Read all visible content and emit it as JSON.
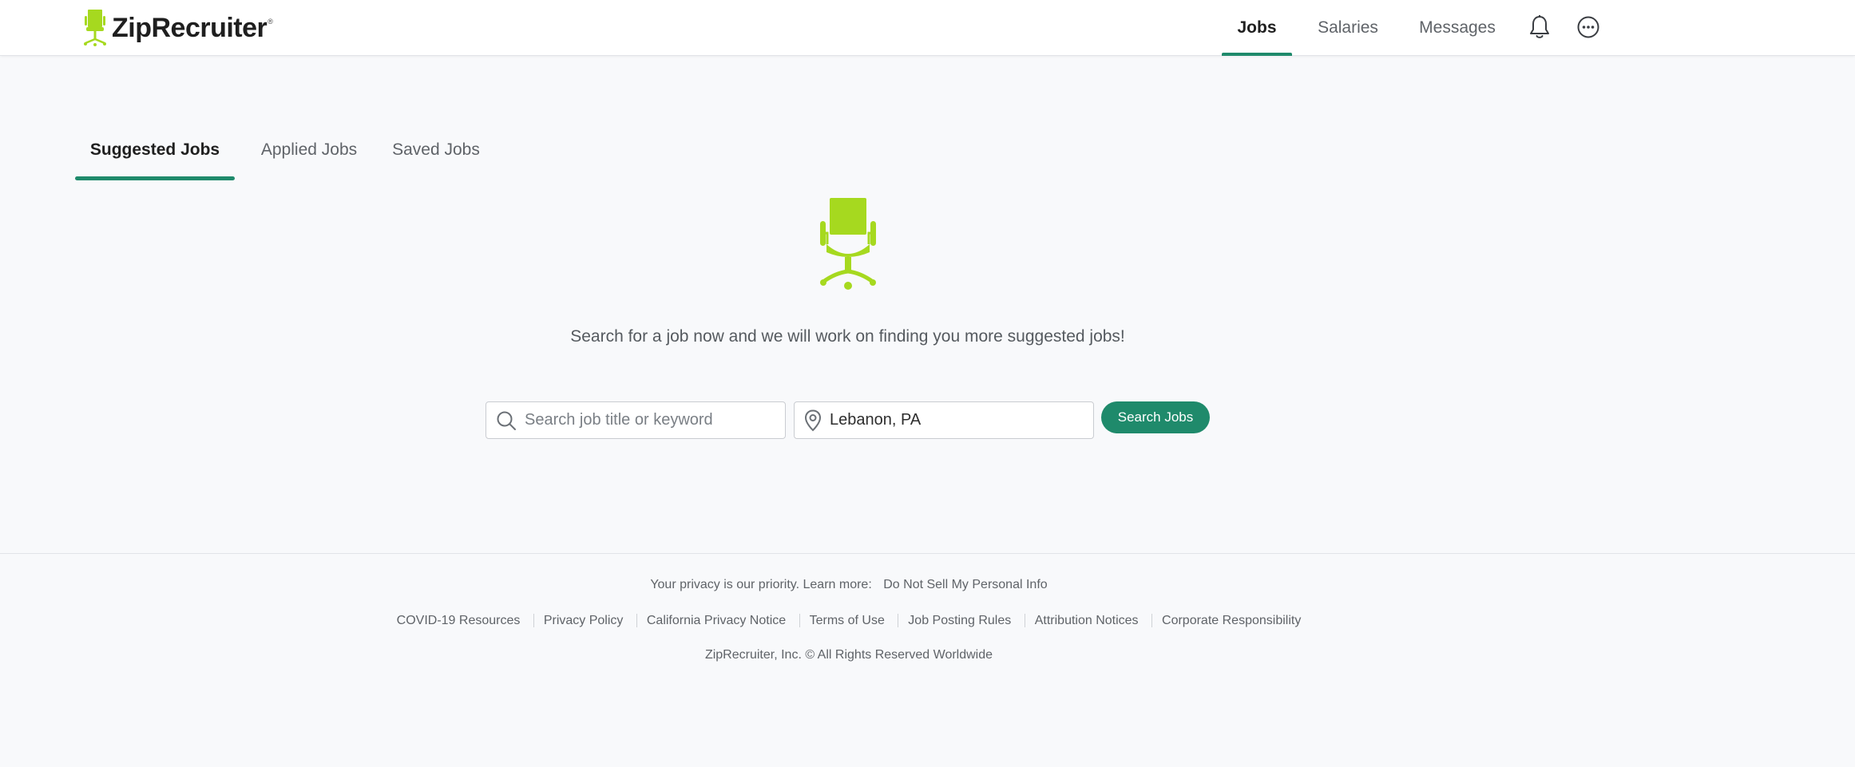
{
  "brand": {
    "name": "ZipRecruiter",
    "trademark": "®",
    "accent_color": "#1f8a6b",
    "logo_color": "#a6d91f"
  },
  "nav": {
    "jobs": "Jobs",
    "salaries": "Salaries",
    "messages": "Messages",
    "notifications_icon": "bell-icon",
    "more_icon": "more-options-icon"
  },
  "tabs": {
    "suggested": "Suggested Jobs",
    "applied": "Applied Jobs",
    "saved": "Saved Jobs",
    "active": "Suggested Jobs"
  },
  "empty_state": {
    "message": "Search for a job now and we will work on finding you more suggested jobs!"
  },
  "search": {
    "keyword_placeholder": "Search job title or keyword",
    "keyword_value": "",
    "location_value": "Lebanon, PA",
    "button_label": "Search Jobs"
  },
  "footer": {
    "privacy_text": "Your privacy is our priority. Learn more:",
    "privacy_link": "Do Not Sell My Personal Info",
    "links": [
      "COVID-19 Resources",
      "Privacy Policy",
      "California Privacy Notice",
      "Terms of Use",
      "Job Posting Rules",
      "Attribution Notices",
      "Corporate Responsibility"
    ],
    "copyright": "ZipRecruiter, Inc. © All Rights Reserved Worldwide"
  }
}
